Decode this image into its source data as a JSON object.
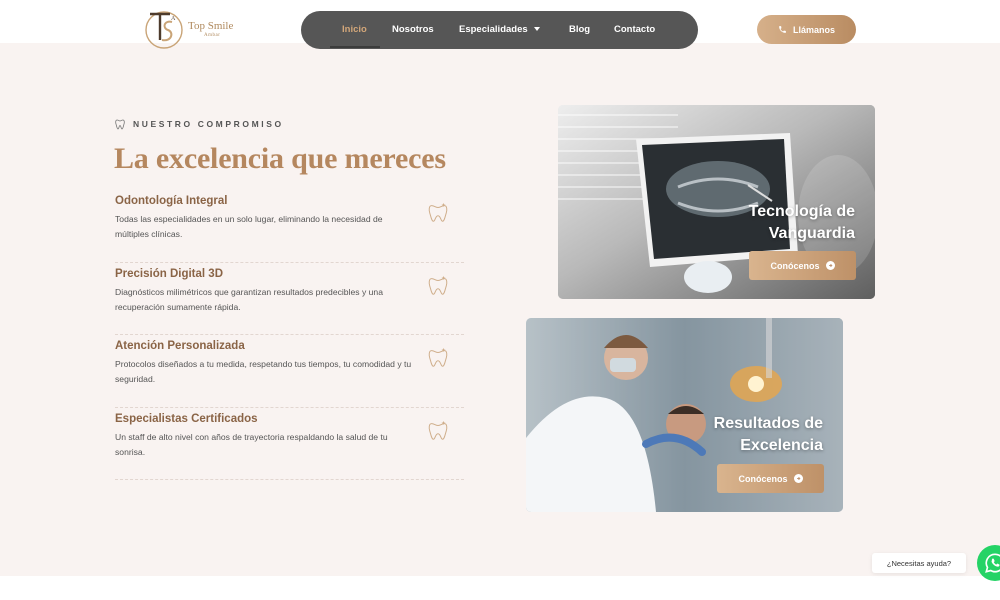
{
  "header": {
    "logo": {
      "name": "Top Smile",
      "sub": "Ambar"
    },
    "nav": [
      {
        "label": "Inicio",
        "active": true
      },
      {
        "label": "Nosotros",
        "active": false
      },
      {
        "label": "Especialidades",
        "active": false,
        "has_dropdown": true
      },
      {
        "label": "Blog",
        "active": false
      },
      {
        "label": "Contacto",
        "active": false
      }
    ],
    "cta": {
      "label": "Llámanos",
      "icon": "phone-icon"
    }
  },
  "main": {
    "eyebrow": "NUESTRO COMPROMISO",
    "headline": "La excelencia que mereces",
    "features": [
      {
        "title": "Odontología Integral",
        "description": "Todas las especialidades en un solo lugar, eliminando la necesidad de múltiples clínicas.",
        "icon": "tooth-sparkle-icon"
      },
      {
        "title": "Precisión Digital 3D",
        "description": "Diagnósticos milimétricos que garantizan resultados predecibles y una recuperación sumamente rápida.",
        "icon": "tooth-sparkle-icon"
      },
      {
        "title": "Atención Personalizada",
        "description": "Protocolos diseñados a tu medida, respetando tus tiempos, tu comodidad y tu seguridad.",
        "icon": "tooth-sparkle-icon"
      },
      {
        "title": "Especialistas Certificados",
        "description": "Un staff de alto nivel con años de trayectoria respaldando la salud de tu sonrisa.",
        "icon": "tooth-sparkle-icon"
      }
    ],
    "cards": [
      {
        "title_line1": "Tecnología de",
        "title_line2": "Vanguardia",
        "button": "Conócenos"
      },
      {
        "title_line1": "Resultados de",
        "title_line2": "Excelencia",
        "button": "Conócenos"
      }
    ]
  },
  "whatsapp": {
    "label": "¿Necesitas ayuda?"
  },
  "colors": {
    "accent": "#b5875f",
    "nav_bg": "#565656",
    "section_bg": "#f9f3f1",
    "whatsapp": "#25d366"
  }
}
